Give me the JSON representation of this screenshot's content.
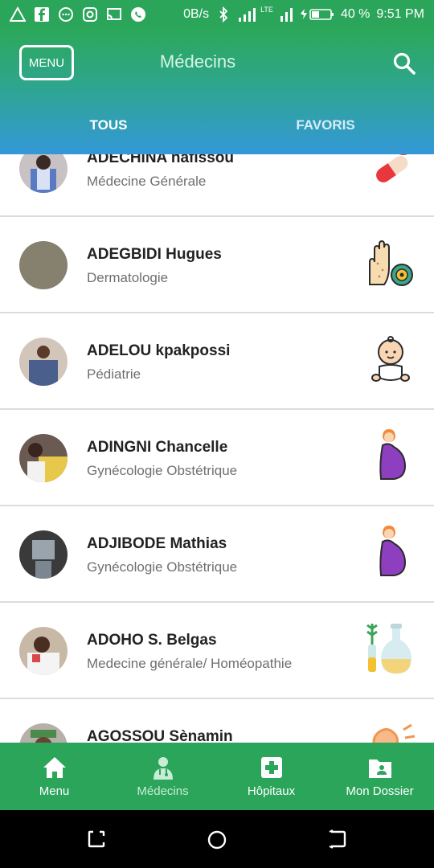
{
  "status_bar": {
    "net_speed": "0B/s",
    "network": "LTE",
    "battery": "40 %",
    "time": "9:51 PM"
  },
  "header": {
    "menu_label": "MENU",
    "title": "Médecins",
    "tabs": [
      {
        "label": "TOUS",
        "active": true
      },
      {
        "label": "FAVORIS",
        "active": false
      }
    ]
  },
  "doctors": [
    {
      "name": "ADECHINA hafissou",
      "specialty": "Médecine Générale",
      "icon": "pills-icon"
    },
    {
      "name": "ADEGBIDI Hugues",
      "specialty": "Dermatologie",
      "icon": "skin-hand-icon"
    },
    {
      "name": "ADELOU kpakpossi",
      "specialty": "Pédiatrie",
      "icon": "baby-icon"
    },
    {
      "name": "ADINGNI Chancelle",
      "specialty": "Gynécologie Obstétrique",
      "icon": "pregnant-woman-icon"
    },
    {
      "name": "ADJIBODE Mathias",
      "specialty": "Gynécologie Obstétrique",
      "icon": "pregnant-woman-icon"
    },
    {
      "name": "ADOHO S. Belgas",
      "specialty": "Medecine générale/ Homéopathie",
      "icon": "herbal-flask-icon"
    },
    {
      "name": "AGOSSOU Sènamin",
      "specialty": "",
      "icon": "ear-icon"
    }
  ],
  "bottom_nav": [
    {
      "label": "Menu",
      "icon": "home-icon",
      "active": false
    },
    {
      "label": "Médecins",
      "icon": "doctor-icon",
      "active": true
    },
    {
      "label": "Hôpitaux",
      "icon": "hospital-cross-icon",
      "active": false
    },
    {
      "label": "Mon Dossier",
      "icon": "folder-user-icon",
      "active": false
    }
  ],
  "colors": {
    "primary_green": "#2aa55a",
    "header_gradient_end": "#3498d8",
    "pregnant_dress": "#8e3fbf"
  }
}
